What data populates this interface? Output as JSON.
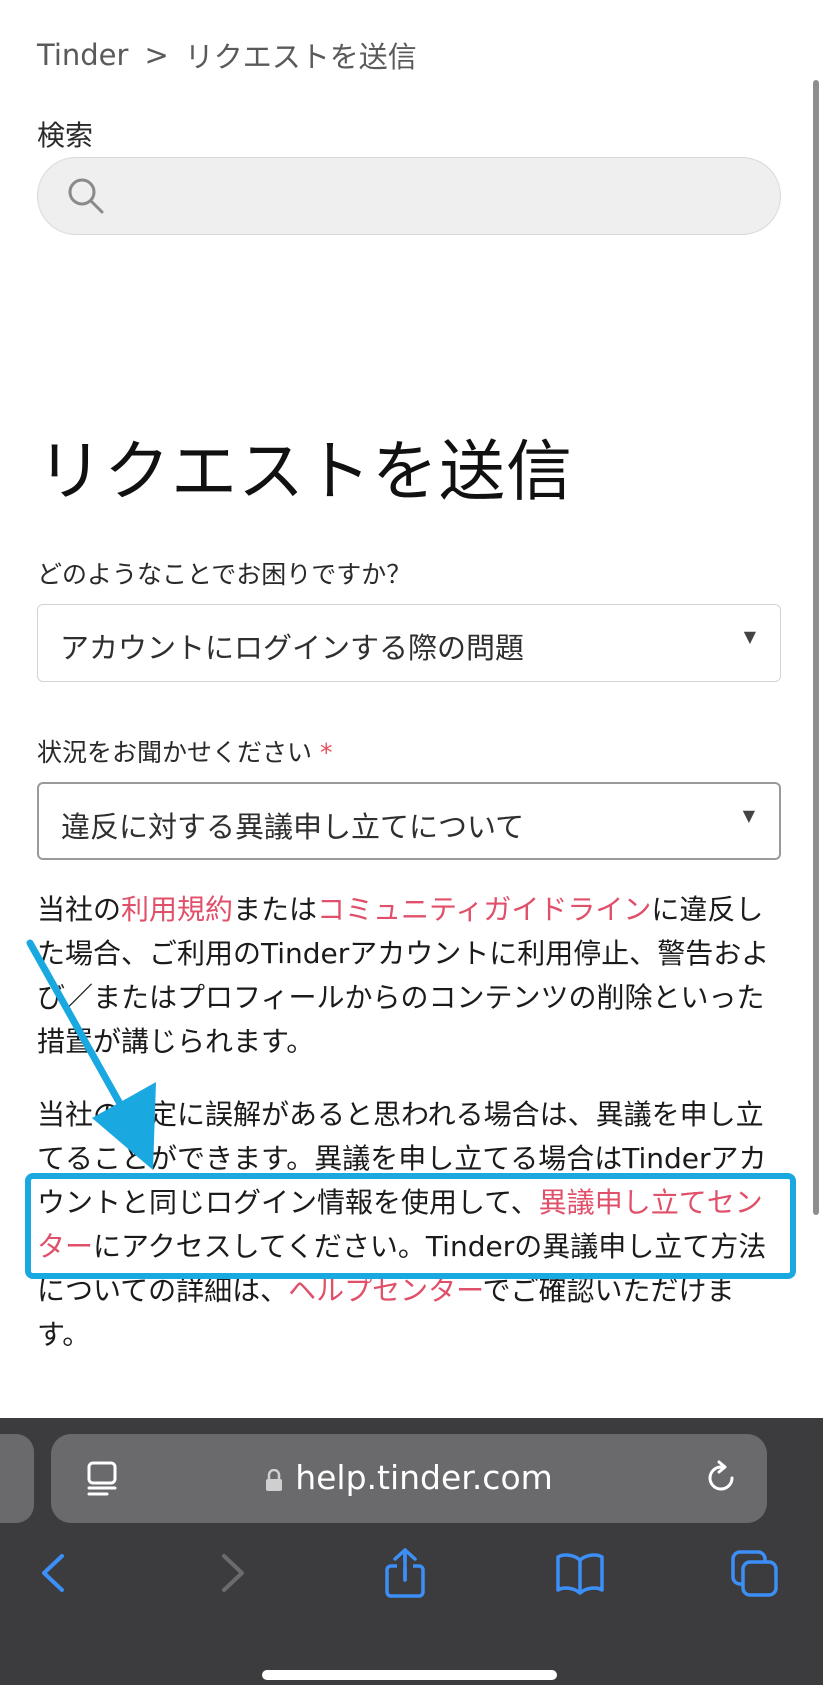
{
  "breadcrumb": {
    "root": "Tinder",
    "separator": ">",
    "current": "リクエストを送信"
  },
  "search": {
    "label": "検索",
    "placeholder": ""
  },
  "page_title": "リクエストを送信",
  "form": {
    "question1": {
      "label": "どのようなことでお困りですか？",
      "value": "アカウントにログインする際の問題"
    },
    "question2": {
      "label": "状況をお聞かせください",
      "required_mark": "*",
      "value": "違反に対する異議申し立てについて"
    },
    "caret": "▼"
  },
  "body": {
    "p1_a": "当社の",
    "p1_link1": "利用規約",
    "p1_b": "または",
    "p1_link2": "コミュニティガイドライン",
    "p1_c": "に違反した場合、ご利用のTinderアカウントに利用停止、警告および／またはプロフィールからのコンテンツの削除といった措置が講じられます。",
    "p2_a": "当社の決定に誤解があると思われる場合は、異議を申し立てることができます。異議を申し立てる場合はTinderアカウントと同じログイン情報を使用して、",
    "p2_link1": "異議申し立てセンター",
    "p2_b": "にアクセスしてください。Tinderの異議申し立て方法についての詳細は、",
    "p2_link2": "ヘルプセンター",
    "p2_c": "でご確認いただけます。"
  },
  "browser": {
    "url": "help.tinder.com"
  },
  "colors": {
    "link": "#e0506a",
    "highlight": "#1aa8e0",
    "toolbar": "#3c3c3e",
    "nav_icon": "#3b8ff6"
  },
  "icons": [
    "search-icon",
    "reader-icon",
    "lock-icon",
    "reload-icon",
    "back-icon",
    "forward-icon",
    "share-icon",
    "bookmarks-icon",
    "tabs-icon"
  ]
}
